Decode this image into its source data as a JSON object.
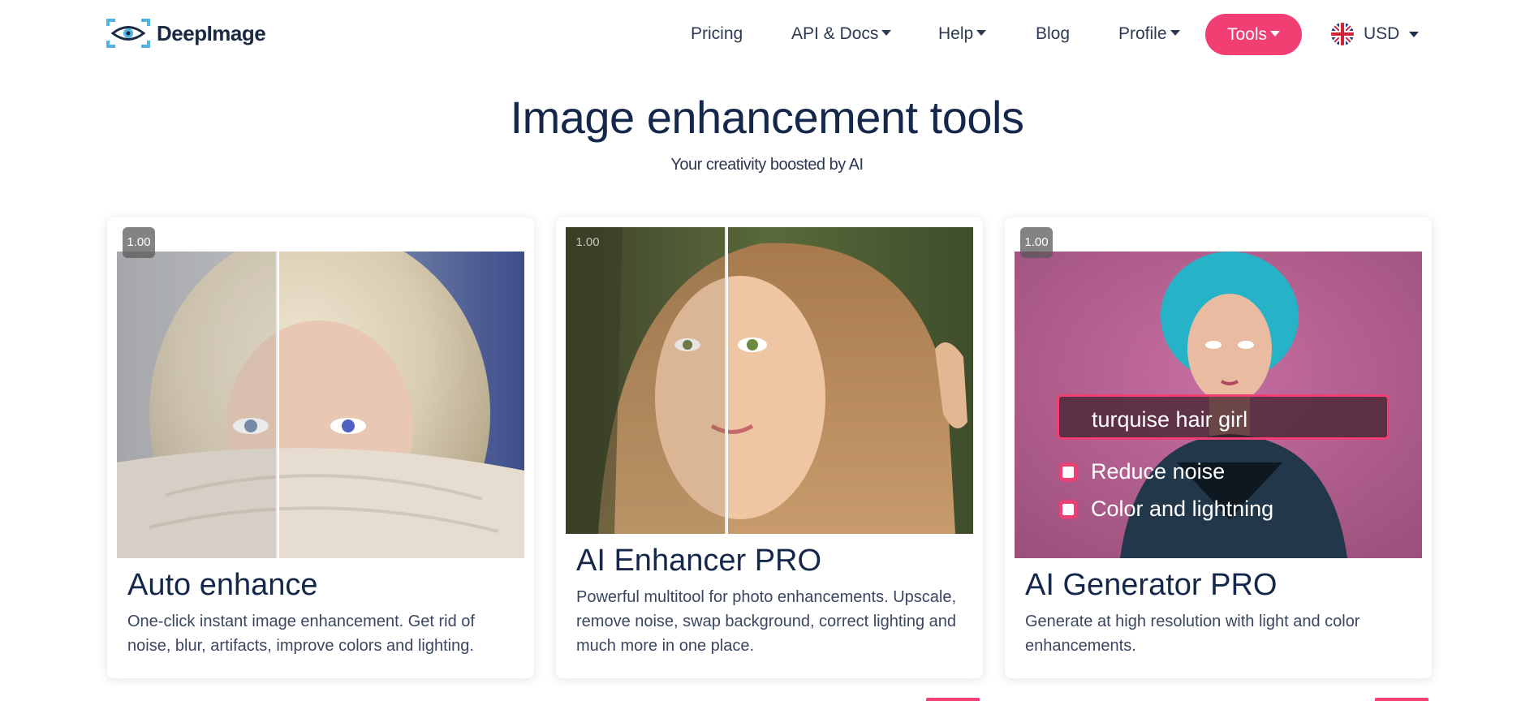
{
  "brand": {
    "name": "DeepImage"
  },
  "nav": {
    "pricing": "Pricing",
    "api_docs": "API & Docs",
    "help": "Help",
    "blog": "Blog",
    "profile": "Profile",
    "tools": "Tools",
    "currency": "USD"
  },
  "hero": {
    "title": "Image enhancement tools",
    "subtitle": "Your creativity boosted by AI"
  },
  "cards": [
    {
      "zoom": "1.00",
      "title": "Auto enhance",
      "description": "One-click instant image enhancement. Get rid of noise, blur, artifacts, improve colors and lighting."
    },
    {
      "zoom": "1.00",
      "title": "AI Enhancer PRO",
      "description": "Powerful multitool for photo enhancements. Upscale, remove noise, swap background, correct lighting and much more in one place."
    },
    {
      "zoom": "1.00",
      "title": "AI Generator PRO",
      "description": "Generate at high resolution with light and color enhancements.",
      "prompt": "turquise hair girl",
      "options": [
        "Reduce noise",
        "Color and lightning"
      ]
    }
  ],
  "colors": {
    "accent": "#f13f73",
    "text_dark": "#15274a",
    "text_body": "#3a4660"
  }
}
